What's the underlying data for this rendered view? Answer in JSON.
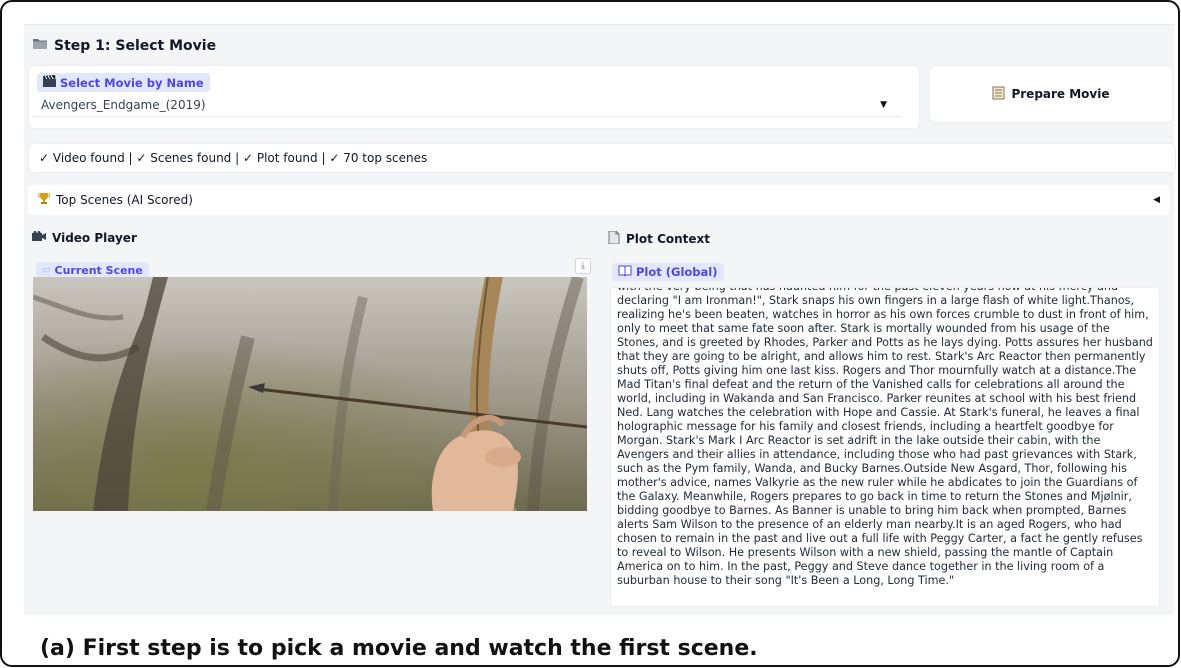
{
  "step": {
    "title": "Step 1: Select Movie"
  },
  "movie_select": {
    "label": "Select Movie by Name",
    "value": "Avengers_Endgame_(2019)"
  },
  "prepare_button": {
    "label": "Prepare Movie"
  },
  "status": {
    "text": "✓ Video found | ✓ Scenes found | ✓ Plot found | ✓ 70 top scenes"
  },
  "top_scenes": {
    "label": "Top Scenes (AI Scored)"
  },
  "video_player": {
    "title": "Video Player",
    "current_scene_label": "Current Scene"
  },
  "plot_context": {
    "title": "Plot Context",
    "plot_label": "Plot (Global)",
    "text": "with the very being that has haunted him for the past eleven years now at his mercy and declaring \"I am Ironman!\", Stark snaps his own fingers in a large flash of white light.Thanos, realizing he's been beaten, watches in horror as his own forces crumble to dust in front of him, only to meet that same fate soon after. Stark is mortally wounded from his usage of the Stones, and is greeted by Rhodes, Parker and Potts as he lays dying. Potts assures her husband that they are going to be alright, and allows him to rest. Stark's Arc Reactor then permanently shuts off, Potts giving him one last kiss. Rogers and Thor mournfully watch at a distance.The Mad Titan's final defeat and the return of the Vanished calls for celebrations all around the world, including in Wakanda and San Francisco. Parker reunites at school with his best friend Ned. Lang watches the celebration with Hope and Cassie. At Stark's funeral, he leaves a final holographic message for his family and closest friends, including a heartfelt goodbye for Morgan. Stark's Mark I Arc Reactor is set adrift in the lake outside their cabin, with the Avengers and their allies in attendance, including those who had past grievances with Stark, such as the Pym family, Wanda, and Bucky Barnes.Outside New Asgard, Thor, following his mother's advice, names Valkyrie as the new ruler while he abdicates to join the Guardians of the Galaxy. Meanwhile, Rogers prepares to go back in time to return the Stones and Mjølnir, bidding goodbye to Barnes. As Banner is unable to bring him back when prompted, Barnes alerts Sam Wilson to the presence of an elderly man nearby.It is an aged Rogers, who had chosen to remain in the past and live out a full life with Peggy Carter, a fact he gently refuses to reveal to Wilson. He presents Wilson with a new shield, passing the mantle of Captain America on to him. In the past, Peggy and Steve dance together in the living room of a suburban house to their song \"It's Been a Long, Long Time.\""
  },
  "caption": "(a) First step is to pick a movie and watch the first scene.",
  "colors": {
    "accent": "#4f46e5",
    "chip_bg": "#e3e7fb",
    "panel_bg": "#f4f5f7"
  }
}
